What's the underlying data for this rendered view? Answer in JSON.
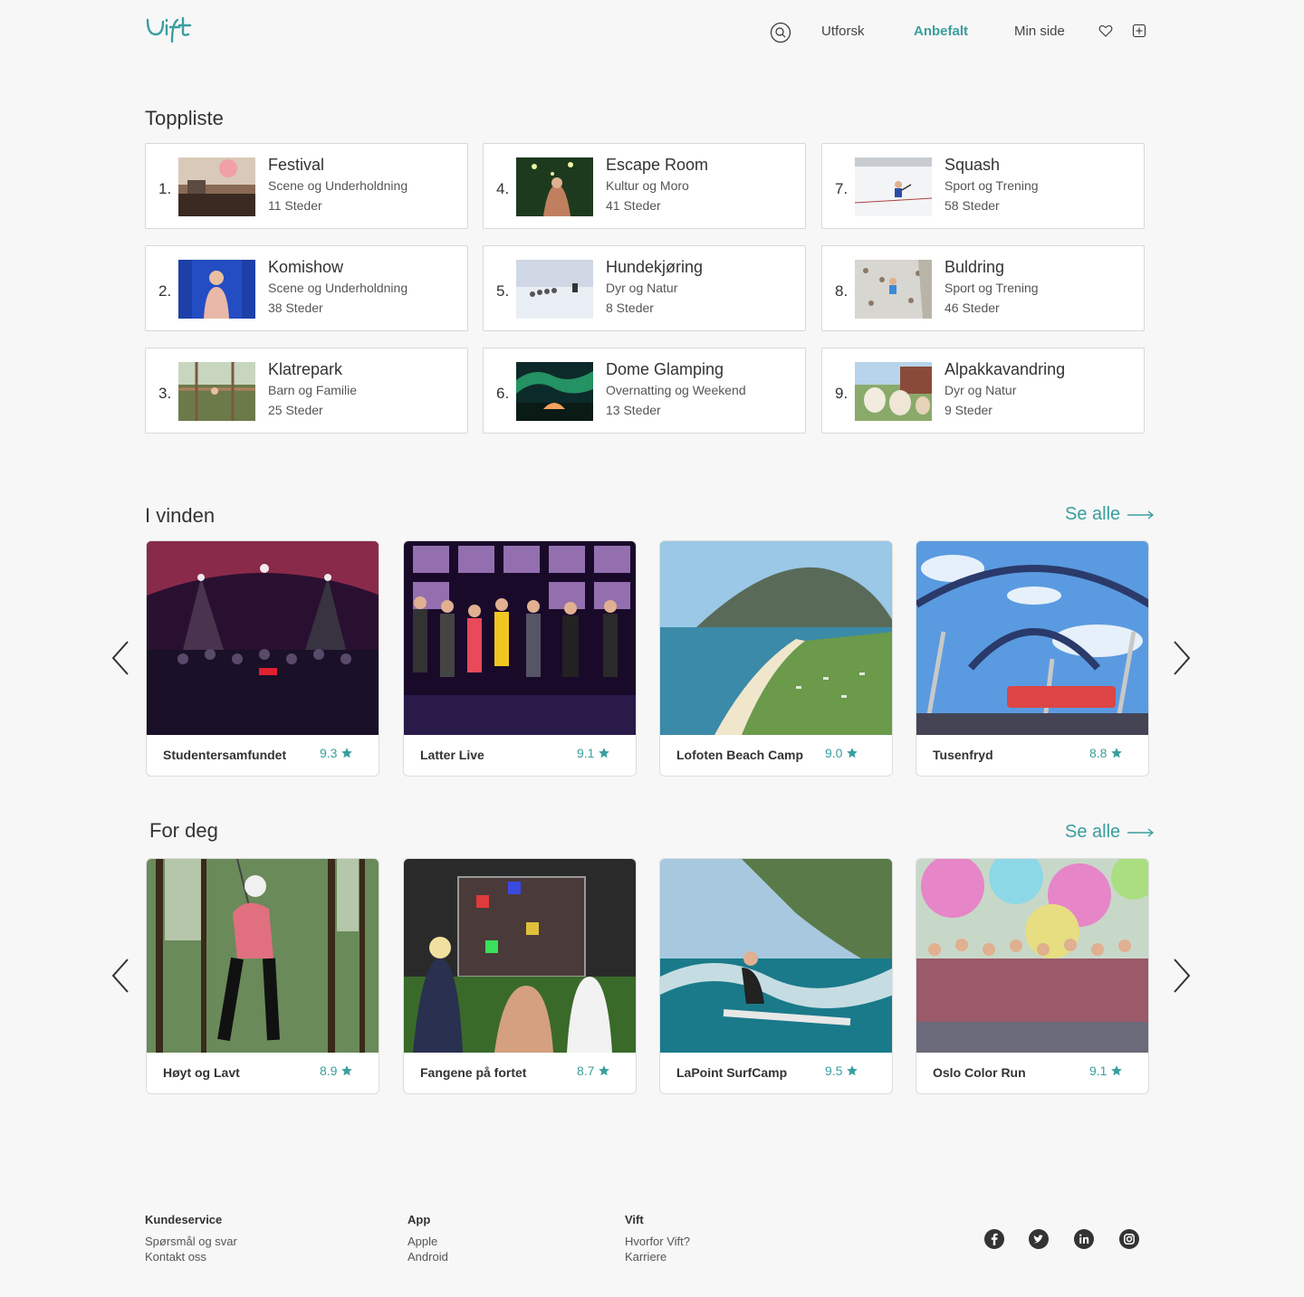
{
  "header": {
    "logo_text": "vift",
    "nav": {
      "explore": "Utforsk",
      "recommended": "Anbefalt",
      "my_page": "Min side"
    },
    "accent_color": "#3a9e9e"
  },
  "toplist": {
    "title": "Toppliste",
    "items": [
      {
        "rank": "1.",
        "title": "Festival",
        "category": "Scene og Underholdning",
        "count": "11 Steder"
      },
      {
        "rank": "2.",
        "title": "Komishow",
        "category": "Scene og Underholdning",
        "count": "38 Steder"
      },
      {
        "rank": "3.",
        "title": "Klatrepark",
        "category": "Barn og Familie",
        "count": "25 Steder"
      },
      {
        "rank": "4.",
        "title": "Escape Room",
        "category": "Kultur og Moro",
        "count": "41 Steder"
      },
      {
        "rank": "5.",
        "title": "Hundekjøring",
        "category": "Dyr og Natur",
        "count": "8 Steder"
      },
      {
        "rank": "6.",
        "title": "Dome Glamping",
        "category": "Overnatting og Weekend",
        "count": "13 Steder"
      },
      {
        "rank": "7.",
        "title": "Squash",
        "category": "Sport og Trening",
        "count": "58 Steder"
      },
      {
        "rank": "8.",
        "title": "Buldring",
        "category": "Sport og Trening",
        "count": "46 Steder"
      },
      {
        "rank": "9.",
        "title": "Alpakkavandring",
        "category": "Dyr og Natur",
        "count": "9 Steder"
      }
    ]
  },
  "trending": {
    "title": "I vinden",
    "see_all": "Se alle",
    "items": [
      {
        "name": "Studentersamfundet",
        "rating": "9.3"
      },
      {
        "name": "Latter Live",
        "rating": "9.1"
      },
      {
        "name": "Lofoten Beach Camp",
        "rating": "9.0"
      },
      {
        "name": "Tusenfryd",
        "rating": "8.8"
      }
    ]
  },
  "for_you": {
    "title": "For deg",
    "see_all": "Se alle",
    "items": [
      {
        "name": "Høyt og Lavt",
        "rating": "8.9"
      },
      {
        "name": "Fangene på fortet",
        "rating": "8.7"
      },
      {
        "name": "LaPoint SurfCamp",
        "rating": "9.5"
      },
      {
        "name": "Oslo Color Run",
        "rating": "9.1"
      }
    ]
  },
  "footer": {
    "columns": [
      {
        "heading": "Kundeservice",
        "links": [
          "Spørsmål og svar",
          "Kontakt oss"
        ]
      },
      {
        "heading": "App",
        "links": [
          "Apple",
          "Android"
        ]
      },
      {
        "heading": "Vift",
        "links": [
          "Hvorfor Vift?",
          "Karriere"
        ]
      }
    ],
    "social": [
      "facebook-icon",
      "twitter-icon",
      "linkedin-icon",
      "instagram-icon"
    ]
  }
}
